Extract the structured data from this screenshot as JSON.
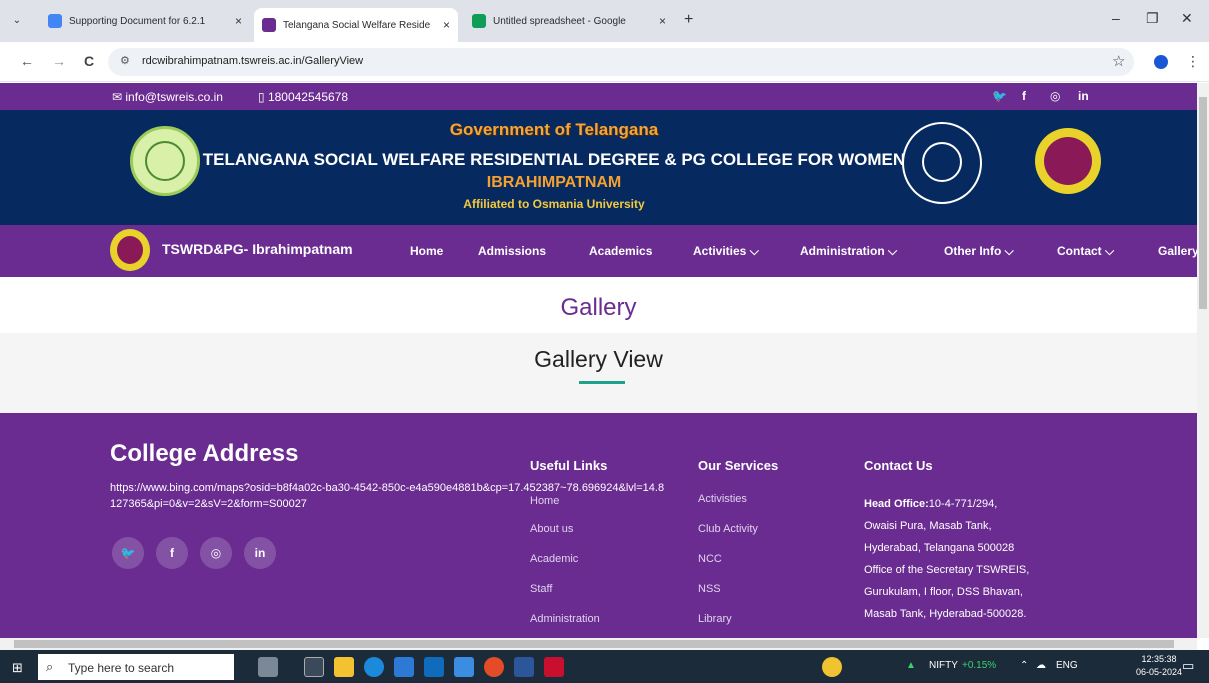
{
  "browser": {
    "tabs": [
      {
        "title": "Supporting Document for 6.2.1",
        "close": "×",
        "favicon_color": "#4285f4",
        "active": false
      },
      {
        "title": "Telangana Social Welfare Reside",
        "close": "×",
        "favicon_color": "#6a2c91",
        "active": true
      },
      {
        "title": "Untitled spreadsheet - Google",
        "close": "×",
        "favicon_color": "#0f9d58",
        "active": false
      }
    ],
    "new_tab": "+",
    "window_controls": {
      "minimize": "–",
      "restore": "❐",
      "close": "✕"
    },
    "tab_dropdown": "⌄",
    "nav": {
      "back": "←",
      "forward": "→",
      "reload": "C"
    },
    "url": "rdcwibrahimpatnam.tswreis.ac.in/GalleryView",
    "bookmark": "☆",
    "menu": "⋮"
  },
  "site": {
    "topbar": {
      "email": "info@tswreis.co.in",
      "phone": "180042545678",
      "social": [
        "twitter-icon",
        "facebook-icon",
        "instagram-icon",
        "linkedin-icon"
      ]
    },
    "banner": {
      "government": "Government of Telangana",
      "college": "TELANGANA SOCIAL WELFARE RESIDENTIAL DEGREE & PG COLLEGE FOR WOMEN",
      "place": "IBRAHIMPATNAM",
      "affiliation": "Affiliated to Osmania University"
    },
    "nav": {
      "brand": "TSWRD&PG- Ibrahimpatnam",
      "items": [
        "Home",
        "Admissions",
        "Academics",
        "Activities ⌵",
        "Administration ⌵",
        "Other Info ⌵",
        "Contact ⌵",
        "Gallery"
      ]
    },
    "page_title": "Gallery",
    "section_title": "Gallery View",
    "footer": {
      "college_address_title": "College Address",
      "address_text": "https://www.bing.com/maps?osid=b8f4a02c-ba30-4542-850c-e4a590e4881b&cp=17.452387~78.696924&lvl=14.8127365&pi=0&v=2&sV=2&form=S00027",
      "useful_links_title": "Useful Links",
      "useful_links": [
        "Home",
        "About us",
        "Academic",
        "Staff",
        "Administration"
      ],
      "services_title": "Our Services",
      "services": [
        "Activisties",
        "Club Activity",
        "NCC",
        "NSS",
        "Library"
      ],
      "contact_title": "Contact Us",
      "contact_head_label": "Head Office:",
      "contact_lines": [
        "10-4-771/294,",
        "Owaisi Pura, Masab Tank,",
        "Hyderabad, Telangana 500028",
        "Office of the Secretary TSWREIS,",
        "Gurukulam, I floor, DSS Bhavan,",
        "Masab Tank, Hyderabad-500028."
      ]
    }
  },
  "taskbar": {
    "search_placeholder": "Type here to search",
    "nifty_label": "NIFTY",
    "nifty_change": "+0.15%",
    "language": "ENG",
    "time": "12:35:38",
    "date": "06-05-2024"
  },
  "colors": {
    "brand_purple": "#6a2c91",
    "banner_navy": "#062a5f",
    "accent_teal": "#1fa28c",
    "nifty_green": "#3bd16f"
  }
}
